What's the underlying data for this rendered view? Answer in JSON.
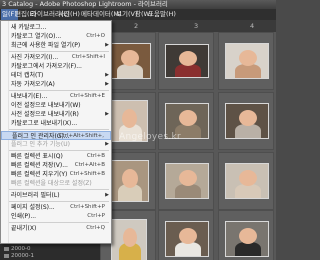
{
  "titlebar": {
    "text": "3 Catalog - Adobe Photoshop Lightroom - 라이브러리"
  },
  "menubar": {
    "items": [
      "일(F)",
      "편집(E)",
      "라이브러리(L)",
      "사진(H)",
      "메타데이터(M)",
      "보기(V)",
      "창(W)",
      "도움말(H)"
    ],
    "active_index": 0
  },
  "topstrip": {
    "numbers": [
      "2",
      "3",
      "4"
    ]
  },
  "sidepanel": {
    "folders": [
      "2000-0",
      "20000-1"
    ]
  },
  "watermark": {
    "text": "Angeloyes.kr"
  },
  "colors": {
    "menu_highlight": "#c8d9f2",
    "menubar_active": "#4a6ea9",
    "grid_bg": "#585858"
  },
  "menu": {
    "items": [
      {
        "label": "새 카탈로그...",
        "shortcut": "",
        "sub": false,
        "disabled": false
      },
      {
        "label": "카탈로그 열기(O)...",
        "shortcut": "Ctrl+O",
        "sub": false,
        "disabled": false
      },
      {
        "label": "최근에 사용한 파일 열기(P)",
        "shortcut": "",
        "sub": true,
        "disabled": false
      },
      {
        "label": "",
        "separator": true
      },
      {
        "label": "사진 가져오기(I)...",
        "shortcut": "Ctrl+Shift+I",
        "sub": false,
        "disabled": false
      },
      {
        "label": "카탈로그에서 가져오기(F)...",
        "shortcut": "",
        "sub": false,
        "disabled": false
      },
      {
        "label": "테더 캡처(T)",
        "shortcut": "",
        "sub": true,
        "disabled": false
      },
      {
        "label": "자동 가져오기(A)",
        "shortcut": "",
        "sub": true,
        "disabled": false
      },
      {
        "label": "",
        "separator": true
      },
      {
        "label": "내보내기(E)...",
        "shortcut": "Ctrl+Shift+E",
        "sub": false,
        "disabled": false
      },
      {
        "label": "이전 설정으로 내보내기(W)",
        "shortcut": "",
        "sub": false,
        "disabled": false
      },
      {
        "label": "사전 설정으로 내보내기(R)",
        "shortcut": "",
        "sub": true,
        "disabled": false
      },
      {
        "label": "카탈로그로 내보내기(X)...",
        "shortcut": "",
        "sub": false,
        "disabled": false
      },
      {
        "label": "",
        "separator": true
      },
      {
        "label": "플러그 인 관리자(G)...",
        "shortcut": "Ctrl+Alt+Shift+,",
        "sub": false,
        "disabled": false,
        "highlighted": true
      },
      {
        "label": "플러그 인 추가 기능(U)",
        "shortcut": "",
        "sub": true,
        "disabled": true
      },
      {
        "label": "",
        "separator": true
      },
      {
        "label": "빠른 컬렉션 표시(Q)",
        "shortcut": "Ctrl+B",
        "sub": false,
        "disabled": false
      },
      {
        "label": "빠른 컬렉션 저장(V)...",
        "shortcut": "Ctrl+Alt+B",
        "sub": false,
        "disabled": false
      },
      {
        "label": "빠른 컬렉션 지우기(Y)",
        "shortcut": "Ctrl+Shift+B",
        "sub": false,
        "disabled": false
      },
      {
        "label": "빠른 컬렉션을 대상으로 설정(Z)",
        "shortcut": "",
        "sub": false,
        "disabled": true
      },
      {
        "label": "",
        "separator": true
      },
      {
        "label": "라이브러리 필터(L)",
        "shortcut": "",
        "sub": true,
        "disabled": false
      },
      {
        "label": "",
        "separator": true
      },
      {
        "label": "페이지 설정(S)...",
        "shortcut": "Ctrl+Shift+P",
        "sub": false,
        "disabled": false
      },
      {
        "label": "인쇄(P)...",
        "shortcut": "Ctrl+P",
        "sub": false,
        "disabled": false
      },
      {
        "label": "",
        "separator": true
      },
      {
        "label": "끝내기(X)",
        "shortcut": "Ctrl+Q",
        "sub": false,
        "disabled": false
      }
    ]
  }
}
